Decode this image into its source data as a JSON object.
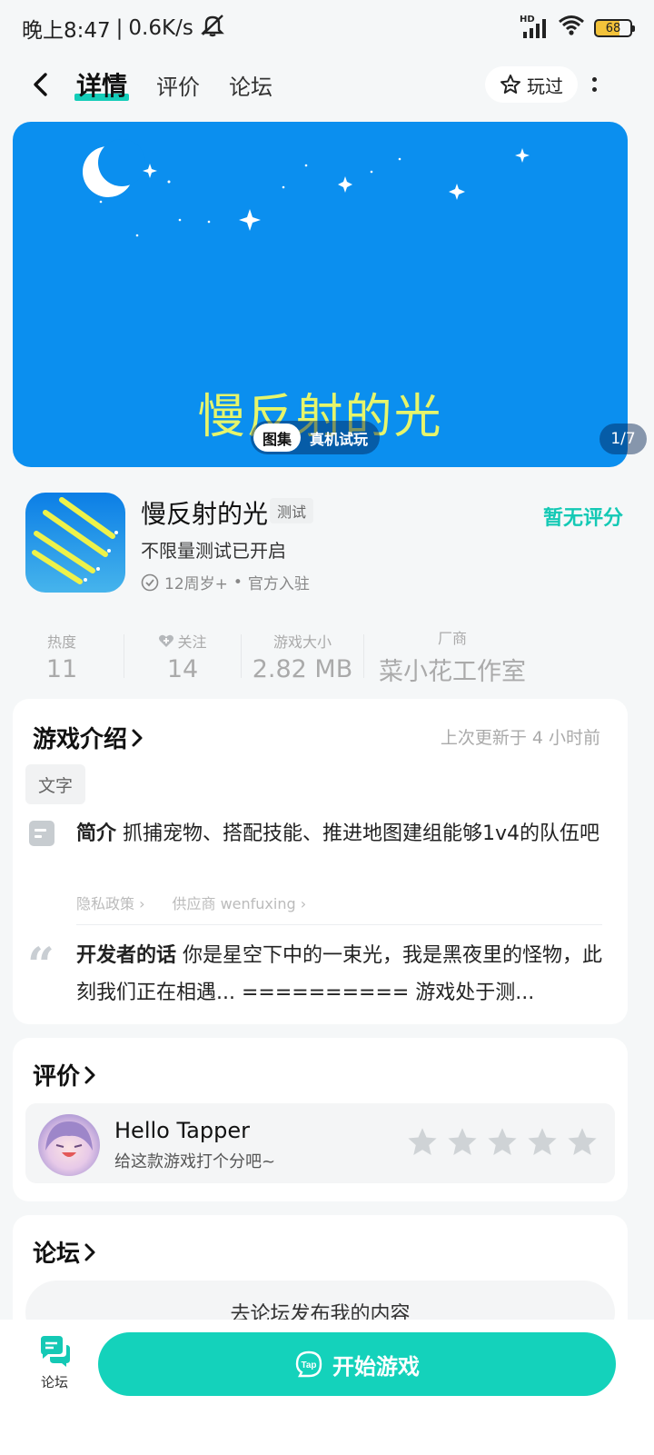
{
  "status": {
    "time": "晚上8:47",
    "sep": "|",
    "speed": "0.6K/s",
    "battery": "68",
    "hd": "HD"
  },
  "nav": {
    "tabs": [
      {
        "label": "详情",
        "active": true
      },
      {
        "label": "评价",
        "active": false
      },
      {
        "label": "论坛",
        "active": false
      }
    ],
    "played_label": "玩过"
  },
  "banner": {
    "title": "慢反射的光",
    "seg_gallery": "图集",
    "seg_trial": "真机试玩",
    "counter": "1/7",
    "bg_color": "#0b8fef",
    "title_color": "#e6f56b"
  },
  "game": {
    "name": "慢反射的光",
    "badge": "测试",
    "subtitle": "不限量测试已开启",
    "age": "12周岁+",
    "dot": "•",
    "official": "官方入驻",
    "rating": "暂无评分"
  },
  "stats": [
    {
      "label": "热度",
      "value": "11"
    },
    {
      "label": "关注",
      "value": "14"
    },
    {
      "label": "游戏大小",
      "value": "2.82 MB"
    },
    {
      "label": "厂商",
      "value": "菜小花工作室"
    }
  ],
  "intro": {
    "title": "游戏介绍",
    "updated": "上次更新于 4 小时前",
    "tag": "文字",
    "desc_label": "简介",
    "desc_text": "抓捕宠物、搭配技能、推进地图建组能够1v4的队伍吧",
    "privacy": "隐私政策",
    "supplier": "供应商 wenfuxing",
    "dev_label": "开发者的话",
    "dev_text": "你是星空下中的一束光，我是黑夜里的怪物，此刻我们正在相遇... ========== 游戏处于测..."
  },
  "review": {
    "title": "评价",
    "user": "Hello Tapper",
    "hint": "给这款游戏打个分吧~",
    "stars": 0
  },
  "forum": {
    "title": "论坛",
    "post_label": "去论坛发布我的内容"
  },
  "bottom": {
    "forum_label": "论坛",
    "start_label": "开始游戏",
    "accent": "#14d2bb"
  }
}
